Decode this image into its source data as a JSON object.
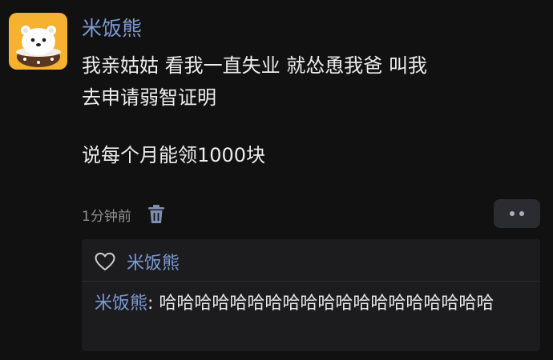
{
  "post": {
    "author": "米饭熊",
    "lines": [
      "我亲姑姑  看我一直失业  就怂恿我爸  叫我",
      "去申请弱智证明"
    ],
    "line_extra": "说每个月能领1000块",
    "time": "1分钟前"
  },
  "icons": {
    "avatar": "polar-bear-avatar-icon",
    "delete": "trash-icon",
    "more": "more-dots-icon",
    "like": "heart-outline-icon"
  },
  "colors": {
    "background": "#111111",
    "username": "#7c9ad6",
    "avatar_bg": "#f5b12f",
    "panel": "#1c1c1e"
  },
  "likes": {
    "names": "米饭熊"
  },
  "reply": {
    "author": "米饭熊",
    "separator": ": ",
    "text": "哈哈哈哈哈哈哈哈哈哈哈哈哈哈哈哈哈哈哈"
  }
}
